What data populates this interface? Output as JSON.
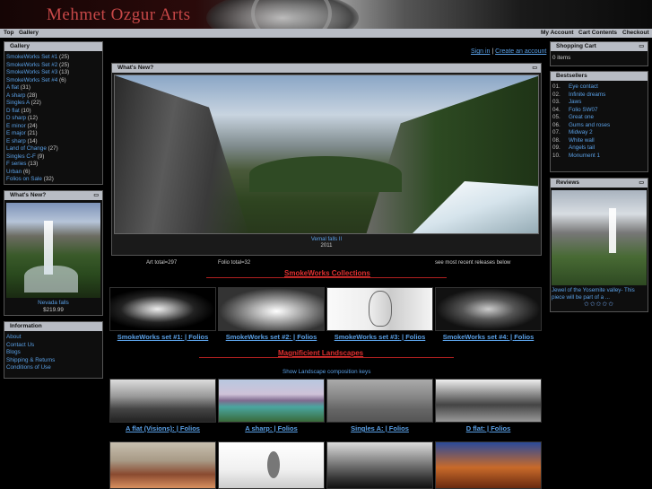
{
  "header": {
    "site_title": "Mehmet Ozgur Arts"
  },
  "nav": {
    "top": "Top",
    "gallery": "Gallery",
    "my_account": "My Account",
    "cart_contents": "Cart Contents",
    "checkout": "Checkout"
  },
  "gallery": {
    "title": "Gallery",
    "items": [
      {
        "label": "SmokeWorks Set #1",
        "count": "(25)"
      },
      {
        "label": "SmokeWorks Set #2",
        "count": "(25)"
      },
      {
        "label": "SmokeWorks Set #3",
        "count": "(13)"
      },
      {
        "label": "SmokeWorks Set #4",
        "count": "(6)"
      },
      {
        "label": "A flat",
        "count": "(31)"
      },
      {
        "label": "A sharp",
        "count": "(28)"
      },
      {
        "label": "Singles A",
        "count": "(22)"
      },
      {
        "label": "D flat",
        "count": "(10)"
      },
      {
        "label": "D sharp",
        "count": "(12)"
      },
      {
        "label": "E minor",
        "count": "(24)"
      },
      {
        "label": "E major",
        "count": "(21)"
      },
      {
        "label": "E sharp",
        "count": "(14)"
      },
      {
        "label": "Land of Change",
        "count": "(27)"
      },
      {
        "label": "Singles C-F",
        "count": "(9)"
      },
      {
        "label": "F series",
        "count": "(13)"
      },
      {
        "label": "Urban",
        "count": "(6)"
      },
      {
        "label": "Folios on Sale",
        "count": "(32)"
      }
    ]
  },
  "whats_new_side": {
    "title": "What's New?",
    "caption": "Nevada falls",
    "price": "$219.99"
  },
  "information": {
    "title": "Information",
    "items": [
      "About",
      "Contact Us",
      "Blogs",
      "Shipping & Returns",
      "Conditions of Use"
    ]
  },
  "account": {
    "sign_in": "Sign in",
    "separator": "|",
    "create": "Create an account"
  },
  "feature": {
    "title": "What's New?",
    "caption": "Vernal falls II",
    "year": "2011",
    "art_total": "Art total=297",
    "folio_total": "Folio total=32",
    "recent": "see most recent releases below"
  },
  "smokeworks": {
    "title": "SmokeWorks Collections",
    "items": [
      {
        "set": "SmokeWorks set #1:",
        "folios": "Folios"
      },
      {
        "set": "SmokeWorks set #2:",
        "folios": "Folios"
      },
      {
        "set": "SmokeWorks set #3:",
        "folios": "Folios"
      },
      {
        "set": "SmokeWorks set #4:",
        "folios": "Folios"
      }
    ]
  },
  "landscapes": {
    "title": "Magnificient Landscapes",
    "keys": "Show Landscape composition keys",
    "items": [
      {
        "set": "A flat (Visions):",
        "folios": "Folios"
      },
      {
        "set": "A sharp:",
        "folios": "Folios"
      },
      {
        "set": "Singles A:",
        "folios": "Folios"
      },
      {
        "set": "D flat:",
        "folios": "Folios"
      }
    ]
  },
  "cart": {
    "title": "Shopping Cart",
    "items": "0 items"
  },
  "bestsellers": {
    "title": "Bestsellers",
    "items": [
      {
        "n": "01.",
        "label": "Eye contact"
      },
      {
        "n": "02.",
        "label": "Infinite dreams"
      },
      {
        "n": "03.",
        "label": "Jaws"
      },
      {
        "n": "04.",
        "label": "Folio SW07"
      },
      {
        "n": "05.",
        "label": "Great one"
      },
      {
        "n": "06.",
        "label": "Gums and roses"
      },
      {
        "n": "07.",
        "label": "Midway 2"
      },
      {
        "n": "08.",
        "label": "White wall"
      },
      {
        "n": "09.",
        "label": "Angels tail"
      },
      {
        "n": "10.",
        "label": "Monument 1"
      }
    ]
  },
  "reviews": {
    "title": "Reviews",
    "text": "Jewel of the Yosemite valley- This piece will be part of a ...",
    "stars": "✩✩✩✩✩"
  }
}
